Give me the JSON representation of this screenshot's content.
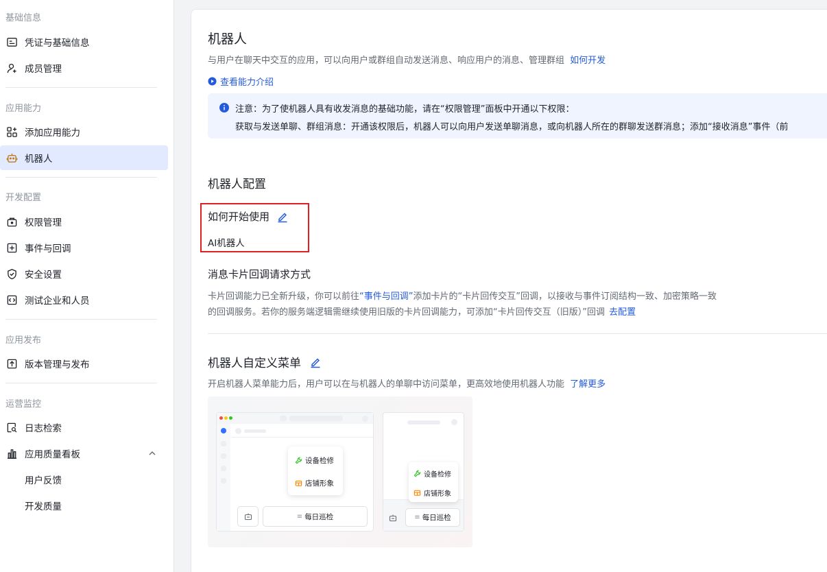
{
  "sidebar": {
    "sections": [
      {
        "title": "基础信息",
        "items": [
          {
            "label": "凭证与基础信息",
            "icon": "credential-icon"
          },
          {
            "label": "成员管理",
            "icon": "add-member-icon"
          }
        ]
      },
      {
        "title": "应用能力",
        "items": [
          {
            "label": "添加应用能力",
            "icon": "app-grid-icon"
          },
          {
            "label": "机器人",
            "icon": "robot-icon",
            "active": true
          }
        ]
      },
      {
        "title": "开发配置",
        "items": [
          {
            "label": "权限管理",
            "icon": "permission-icon"
          },
          {
            "label": "事件与回调",
            "icon": "event-icon"
          },
          {
            "label": "安全设置",
            "icon": "shield-icon"
          },
          {
            "label": "测试企业和人员",
            "icon": "code-icon"
          }
        ]
      },
      {
        "title": "应用发布",
        "items": [
          {
            "label": "版本管理与发布",
            "icon": "upload-icon"
          }
        ]
      },
      {
        "title": "运营监控",
        "items": [
          {
            "label": "日志检索",
            "icon": "log-search-icon"
          },
          {
            "label": "应用质量看板",
            "icon": "bar-chart-icon",
            "expanded": true
          }
        ]
      }
    ],
    "sub_items": [
      "用户反馈",
      "开发质量"
    ]
  },
  "main": {
    "title": "机器人",
    "description": "与用户在聊天中交互的应用，可以向用户或群组自动发送消息、响应用户的消息、管理群组",
    "how_to_dev_link": "如何开发",
    "ability_link": "查看能力介绍",
    "notice": {
      "line1": "注意：为了使机器人具有收发消息的基础功能，请在“权限管理”面板中开通以下权限：",
      "line2": "获取与发送单聊、群组消息：开通该权限后，机器人可以向用户发送单聊消息，或向机器人所在的群聊发送群消息；添加“接收消息”事件（前"
    },
    "config_title": "机器人配置",
    "how_to_use_label": "如何开始使用",
    "how_to_use_value": "AI机器人",
    "card_callback": {
      "title": "消息卡片回调请求方式",
      "line1_a": "卡片回调能力已全新升级，你可以前往",
      "line1_link": "“事件与回调”",
      "line1_b": "添加卡片的“卡片回传交互”回调，以接收与事件订阅结构一致、加密策略一致",
      "line2": "的回调服务。若你的服务端逻辑需继续使用旧版的卡片回调能力，可添加“卡片回传交互（旧版）”回调",
      "line2_link": "去配置"
    },
    "menu": {
      "title": "机器人自定义菜单",
      "description": "开启机器人菜单能力后，用户可以在与机器人的单聊中访问菜单，更高效地使用机器人功能",
      "learn_more": "了解更多"
    },
    "illustration": {
      "item1": "设备检修",
      "item2": "店铺形象",
      "daily": "每日巡检"
    }
  },
  "colors": {
    "accent": "#245bdb",
    "active_bg": "#e1eaff",
    "highlight": "#e02020"
  }
}
